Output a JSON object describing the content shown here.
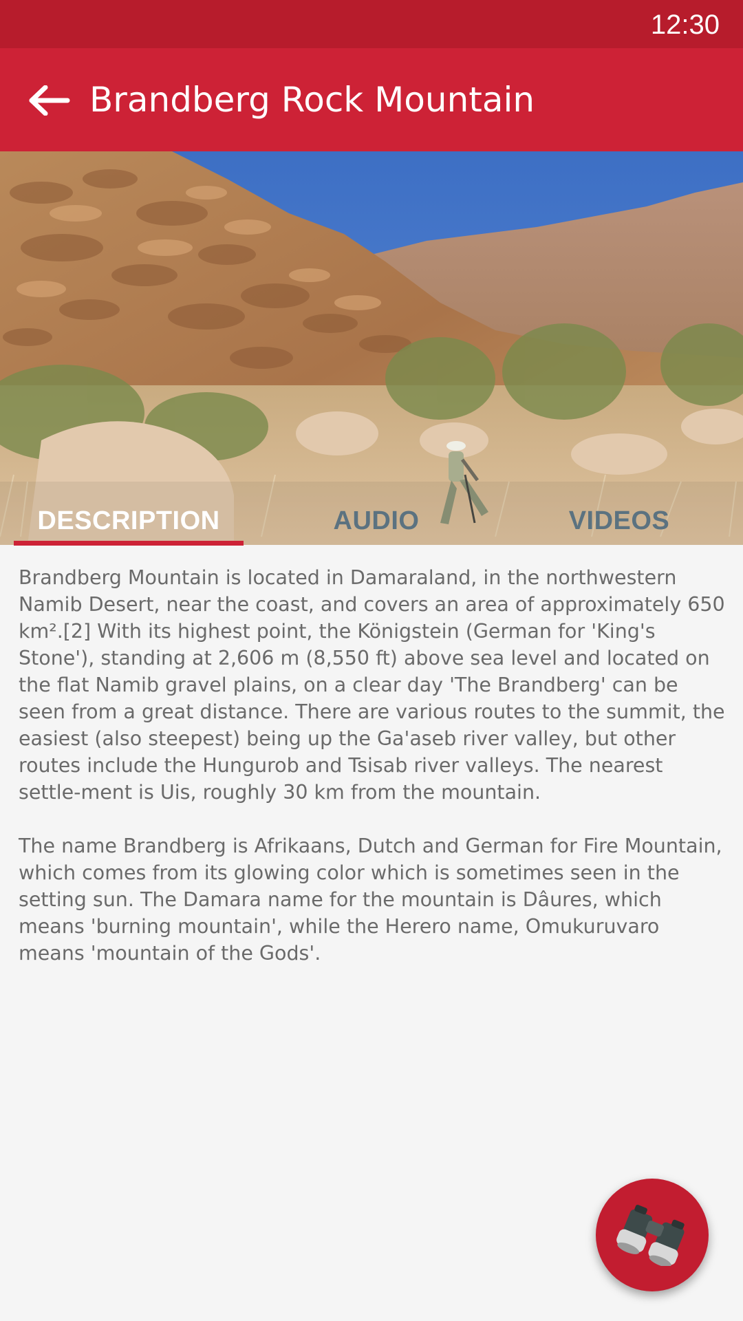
{
  "status_bar": {
    "time": "12:30"
  },
  "app_bar": {
    "title": "Brandberg Rock Mountain",
    "back_icon": "arrow-left-icon"
  },
  "tabs": [
    {
      "label": "DESCRIPTION",
      "selected": true
    },
    {
      "label": "AUDIO",
      "selected": false
    },
    {
      "label": "VIDEOS",
      "selected": false
    }
  ],
  "description": {
    "paragraphs": [
      "Brandberg Mountain is located in Damaraland, in the northwestern Namib Desert, near the coast, and covers an area of approximately 650 km².[2] With its highest point, the Königstein (German for 'King's Stone'), standing at 2,606 m (8,550 ft) above sea level and located on the flat Namib gravel plains, on a clear day 'The Brandberg' can be seen from a great distance. There are various routes to the summit, the easiest (also steepest) being up the Ga'aseb river valley, but other routes include the Hungurob and Tsisab river valleys. The nearest settle-ment is Uis, roughly 30 km from the mountain.",
      "The name Brandberg is Afrikaans, Dutch and German for Fire Mountain, which comes from its glowing color which is sometimes seen in the setting sun. The Damara name for the mountain is Dâures, which means 'burning mountain', while the Herero name, Omukuruvaro means 'mountain of the Gods'."
    ]
  },
  "fab": {
    "icon": "binoculars-icon"
  },
  "colors": {
    "status_bar": "#b71c2c",
    "app_bar": "#cd2236",
    "tab_inactive": "#5b7280",
    "tab_indicator": "#cd2236",
    "fab": "#c21d30",
    "background": "#f5f5f5",
    "body_text": "#6a6a6a"
  }
}
